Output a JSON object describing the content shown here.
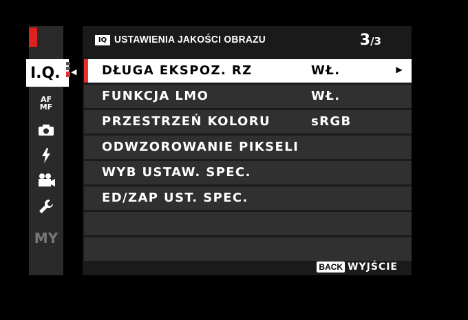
{
  "sidebar": {
    "items": [
      {
        "name": "image-quality",
        "label": "I.Q."
      },
      {
        "name": "af-mf",
        "label_top": "AF",
        "label_bottom": "MF"
      },
      {
        "name": "shooting",
        "icon": "camera-icon"
      },
      {
        "name": "flash",
        "icon": "flash-icon"
      },
      {
        "name": "movie",
        "icon": "movie-camera-icon"
      },
      {
        "name": "setup",
        "icon": "wrench-icon"
      },
      {
        "name": "my-menu",
        "label": "MY"
      }
    ]
  },
  "header": {
    "badge": "IQ",
    "title": "USTAWIENIA JAKOŚCI OBRAZU",
    "page_current": "3",
    "page_total": "/3"
  },
  "menu": {
    "rows": [
      {
        "label": "DŁUGA EKSPOZ. RZ",
        "value": "WŁ.",
        "selected": true
      },
      {
        "label": "FUNKCJA LMO",
        "value": "WŁ."
      },
      {
        "label": "PRZESTRZEŃ KOLORU",
        "value": "sRGB"
      },
      {
        "label": "ODWZOROWANIE PIKSELI",
        "value": ""
      },
      {
        "label": "WYB USTAW. SPEC.",
        "value": ""
      },
      {
        "label": "ED/ZAP UST. SPEC.",
        "value": ""
      },
      {
        "label": "",
        "value": ""
      },
      {
        "label": "",
        "value": ""
      }
    ]
  },
  "footer": {
    "back_badge": "BACK",
    "exit_label": "WYJŚCIE"
  },
  "colors": {
    "accent_red": "#e53030",
    "selected_bg": "#ffffff",
    "row_bg": "#303030"
  }
}
